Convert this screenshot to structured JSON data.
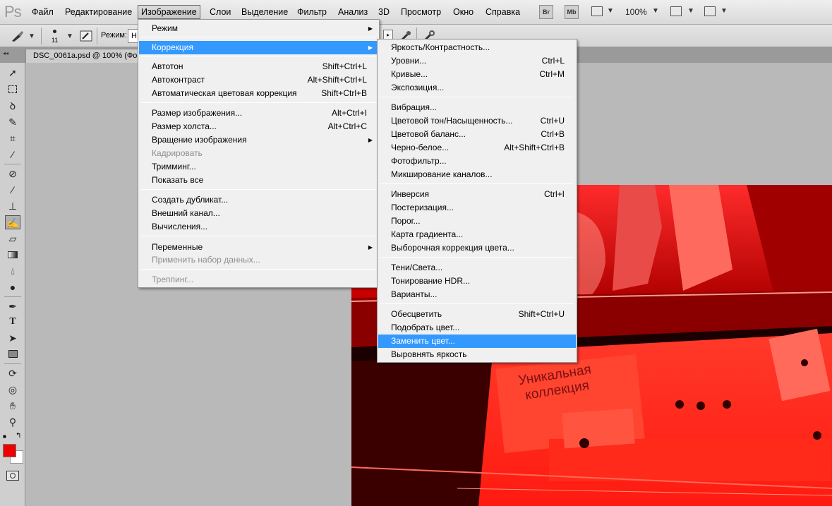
{
  "menubar": {
    "logo": "Ps",
    "items": [
      "Файл",
      "Редактирование",
      "Изображение",
      "Слои",
      "Выделение",
      "Фильтр",
      "Анализ",
      "3D",
      "Просмотр",
      "Окно",
      "Справка"
    ],
    "bridge_label": "Br",
    "minibridge_label": "Mb",
    "zoom": "100%"
  },
  "options": {
    "brush_size": "11",
    "mode_label": "Режим:",
    "mode_value": "Н"
  },
  "document": {
    "tab_title": "DSC_0061a.psd @ 100% (Фо"
  },
  "image_menu": {
    "items": [
      {
        "label": "Режим",
        "shortcut": "",
        "submenu": true,
        "disabled": false
      },
      {
        "label": "Коррекция",
        "shortcut": "",
        "submenu": true,
        "disabled": false
      },
      {
        "label": "Автотон",
        "shortcut": "Shift+Ctrl+L",
        "submenu": false,
        "disabled": false
      },
      {
        "label": "Автоконтраст",
        "shortcut": "Alt+Shift+Ctrl+L",
        "submenu": false,
        "disabled": false
      },
      {
        "label": "Автоматическая цветовая коррекция",
        "shortcut": "Shift+Ctrl+B",
        "submenu": false,
        "disabled": false
      },
      {
        "label": "Размер изображения...",
        "shortcut": "Alt+Ctrl+I",
        "submenu": false,
        "disabled": false
      },
      {
        "label": "Размер холста...",
        "shortcut": "Alt+Ctrl+C",
        "submenu": false,
        "disabled": false
      },
      {
        "label": "Вращение изображения",
        "shortcut": "",
        "submenu": true,
        "disabled": false
      },
      {
        "label": "Кадрировать",
        "shortcut": "",
        "submenu": false,
        "disabled": true
      },
      {
        "label": "Тримминг...",
        "shortcut": "",
        "submenu": false,
        "disabled": false
      },
      {
        "label": "Показать все",
        "shortcut": "",
        "submenu": false,
        "disabled": false
      },
      {
        "label": "Создать дубликат...",
        "shortcut": "",
        "submenu": false,
        "disabled": false
      },
      {
        "label": "Внешний канал...",
        "shortcut": "",
        "submenu": false,
        "disabled": false
      },
      {
        "label": "Вычисления...",
        "shortcut": "",
        "submenu": false,
        "disabled": false
      },
      {
        "label": "Переменные",
        "shortcut": "",
        "submenu": true,
        "disabled": false
      },
      {
        "label": "Применить набор данных...",
        "shortcut": "",
        "submenu": false,
        "disabled": true
      },
      {
        "label": "Треппинг...",
        "shortcut": "",
        "submenu": false,
        "disabled": true
      }
    ]
  },
  "correction_menu": {
    "items": [
      {
        "label": "Яркость/Контрастность...",
        "shortcut": ""
      },
      {
        "label": "Уровни...",
        "shortcut": "Ctrl+L"
      },
      {
        "label": "Кривые...",
        "shortcut": "Ctrl+M"
      },
      {
        "label": "Экспозиция...",
        "shortcut": ""
      },
      {
        "label": "Вибрация...",
        "shortcut": ""
      },
      {
        "label": "Цветовой тон/Насыщенность...",
        "shortcut": "Ctrl+U"
      },
      {
        "label": "Цветовой баланс...",
        "shortcut": "Ctrl+B"
      },
      {
        "label": "Черно-белое...",
        "shortcut": "Alt+Shift+Ctrl+B"
      },
      {
        "label": "Фотофильтр...",
        "shortcut": ""
      },
      {
        "label": "Микширование каналов...",
        "shortcut": ""
      },
      {
        "label": "Инверсия",
        "shortcut": "Ctrl+I"
      },
      {
        "label": "Постеризация...",
        "shortcut": ""
      },
      {
        "label": "Порог...",
        "shortcut": ""
      },
      {
        "label": "Карта градиента...",
        "shortcut": ""
      },
      {
        "label": "Выборочная коррекция цвета...",
        "shortcut": ""
      },
      {
        "label": "Тени/Света...",
        "shortcut": ""
      },
      {
        "label": "Тонирование HDR...",
        "shortcut": ""
      },
      {
        "label": "Варианты...",
        "shortcut": ""
      },
      {
        "label": "Обесцветить",
        "shortcut": "Shift+Ctrl+U"
      },
      {
        "label": "Подобрать цвет...",
        "shortcut": ""
      },
      {
        "label": "Заменить цвет...",
        "shortcut": ""
      },
      {
        "label": "Выровнять яркость",
        "shortcut": ""
      }
    ]
  },
  "photo_text": {
    "line1": "Уникальная",
    "line2": "коллекция"
  },
  "tools": [
    "move-icon",
    "marquee-icon",
    "lasso-icon",
    "quick-selection-icon",
    "crop-icon",
    "eyedropper-icon",
    "healing-brush-icon",
    "brush-icon",
    "clone-stamp-icon",
    "history-brush-icon",
    "eraser-icon",
    "gradient-icon",
    "blur-icon",
    "dodge-icon",
    "pen-icon",
    "type-icon",
    "path-selection-icon",
    "shape-icon",
    "3d-rotate-icon",
    "3d-orbit-icon",
    "hand-icon",
    "zoom-icon"
  ],
  "colors": {
    "foreground": "#ee0000",
    "background": "#ffffff",
    "highlight": "#3399ff"
  }
}
